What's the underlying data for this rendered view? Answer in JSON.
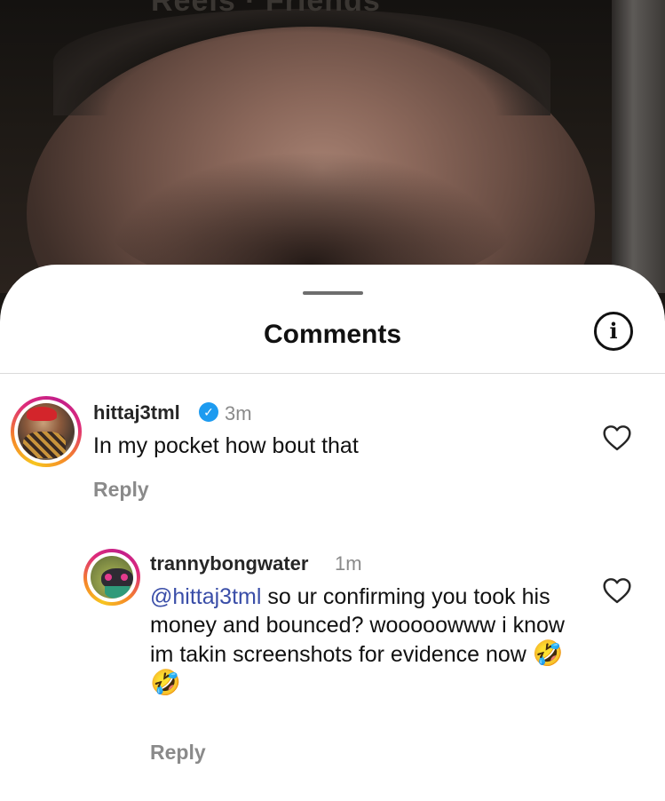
{
  "video": {
    "title_partial": "Reels · Friends"
  },
  "sheet": {
    "title": "Comments",
    "info_icon": "info-icon"
  },
  "comments": [
    {
      "username": "hittaj3tml",
      "verified": true,
      "time": "3m",
      "text": "In my pocket how bout that",
      "reply_label": "Reply"
    },
    {
      "username": "trannybongwater",
      "verified": false,
      "time": "1m",
      "mention": "@hittaj3tml",
      "text": " so ur confirming you took his money and bounced? wooooowww i know im takin screenshots for evidence now ",
      "emoji_1": "🤣",
      "emoji_2": "🤣",
      "reply_label": "Reply"
    }
  ],
  "colors": {
    "verified_badge": "#1d9bf0",
    "mention": "#3a4ea8",
    "meta_gray": "#8a8a8a"
  }
}
